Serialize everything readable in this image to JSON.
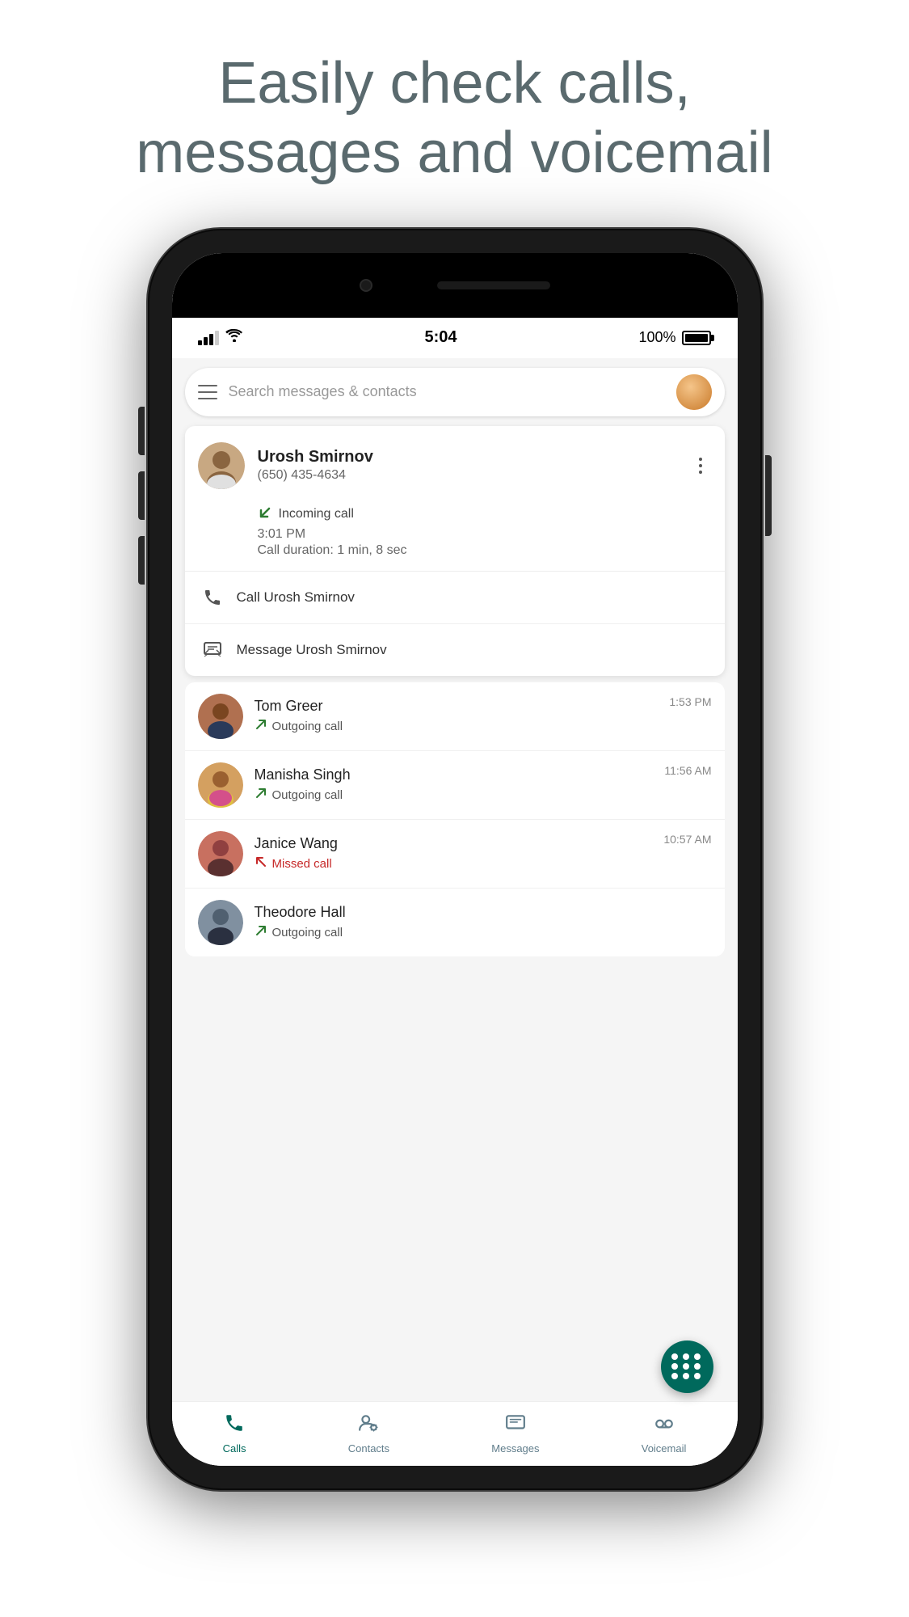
{
  "header": {
    "title": "Easily check calls,\nmessages and voicemail"
  },
  "statusBar": {
    "time": "5:04",
    "battery": "100%",
    "signal": "full"
  },
  "searchBar": {
    "placeholder": "Search messages & contacts"
  },
  "expandedCard": {
    "contact": {
      "name": "Urosh Smirnov",
      "phone": "(650) 435-4634"
    },
    "callDetail": {
      "type": "Incoming call",
      "time": "3:01 PM",
      "duration": "Call duration: 1 min, 8 sec"
    },
    "actions": {
      "call": "Call Urosh Smirnov",
      "message": "Message Urosh Smirnov"
    }
  },
  "callList": [
    {
      "name": "Tom Greer",
      "status": "Outgoing call",
      "statusType": "outgoing",
      "time": "1:53 PM"
    },
    {
      "name": "Manisha Singh",
      "status": "Outgoing call",
      "statusType": "outgoing",
      "time": "11:56 AM"
    },
    {
      "name": "Janice Wang",
      "status": "Missed call",
      "statusType": "missed",
      "time": "10:57 AM"
    },
    {
      "name": "Theodore Hall",
      "status": "Outgoing call",
      "statusType": "outgoing",
      "time": "..."
    }
  ],
  "bottomNav": {
    "items": [
      {
        "label": "Calls",
        "active": true
      },
      {
        "label": "Contacts",
        "active": false
      },
      {
        "label": "Messages",
        "active": false
      },
      {
        "label": "Voicemail",
        "active": false
      }
    ]
  }
}
